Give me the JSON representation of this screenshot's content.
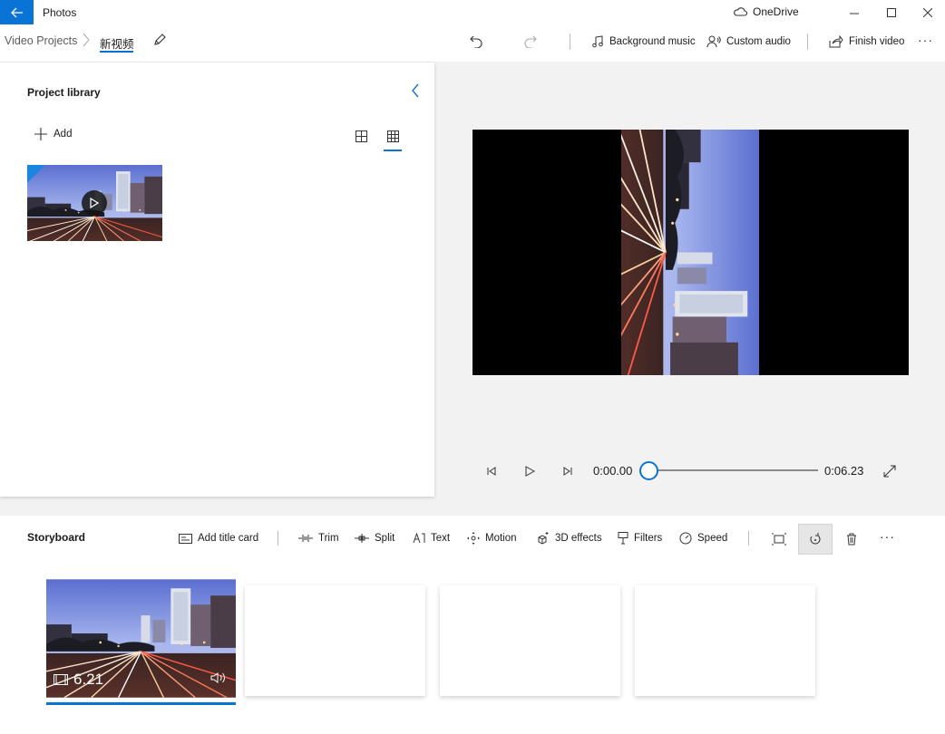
{
  "window": {
    "app_title": "Photos",
    "onedrive_label": "OneDrive",
    "minimize": "–",
    "maximize": "☐",
    "close": "✕"
  },
  "breadcrumb": {
    "root": "Video Projects",
    "separator": ">",
    "current": "新视频"
  },
  "toolbar": {
    "background_music": "Background music",
    "custom_audio": "Custom audio",
    "finish_video": "Finish video",
    "more": "···"
  },
  "library": {
    "title": "Project library",
    "add_label": "Add"
  },
  "transport": {
    "current_time": "0:00.00",
    "total_time": "0:06.23",
    "progress": 0.0
  },
  "storyboard": {
    "title": "Storyboard",
    "actions": {
      "add_title_card": "Add title card",
      "trim": "Trim",
      "split": "Split",
      "text": "Text",
      "motion": "Motion",
      "effects_3d": "3D effects",
      "filters": "Filters",
      "speed": "Speed"
    },
    "more": "···",
    "clips": [
      {
        "duration": "6.21"
      }
    ]
  },
  "colors": {
    "accent": "#0a74d6",
    "panel": "#ffffff",
    "background": "#f2f2f2"
  }
}
